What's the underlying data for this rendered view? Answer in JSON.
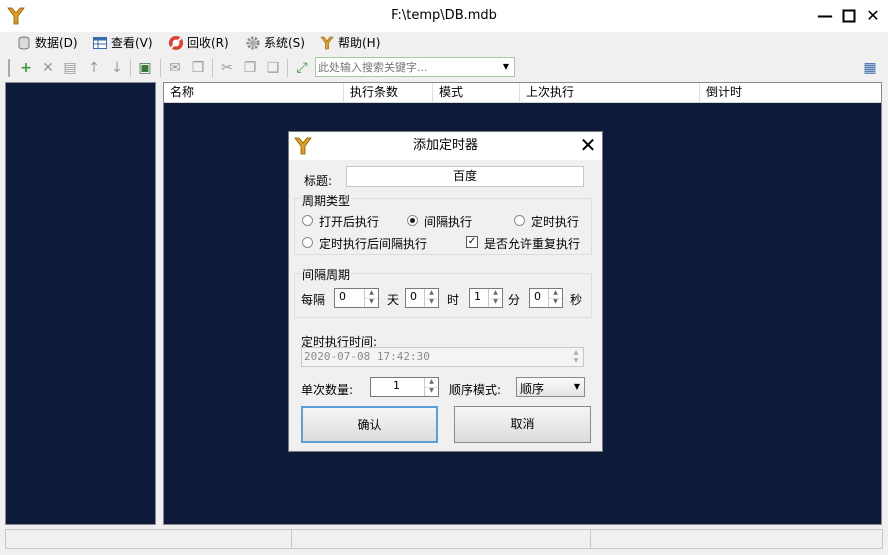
{
  "window": {
    "title": "F:\\temp\\DB.mdb"
  },
  "menu": [
    {
      "label": "数据(D)",
      "icon": "database-icon"
    },
    {
      "label": "查看(V)",
      "icon": "grid-icon"
    },
    {
      "label": "回收(R)",
      "icon": "recycle-icon"
    },
    {
      "label": "系统(S)",
      "icon": "gear-icon"
    },
    {
      "label": "帮助(H)",
      "icon": "help-icon"
    }
  ],
  "toolbar": {
    "search_placeholder": "此处输入搜索关键字..."
  },
  "grid": {
    "columns": [
      "名称",
      "执行条数",
      "模式",
      "上次执行",
      "倒计时"
    ]
  },
  "dialog": {
    "title": "添加定时器",
    "title_label": "标题:",
    "title_value": "百度",
    "period_group": "周期类型",
    "radio_open": "打开后执行",
    "radio_interval": "间隔执行",
    "radio_timed": "定时执行",
    "radio_timed_interval": "定时执行后间隔执行",
    "check_repeat": "是否允许重复执行",
    "interval_group": "间隔周期",
    "every": "每隔",
    "day_value": "0",
    "day_unit": "天",
    "hour_value": "0",
    "hour_unit": "时",
    "minute_value": "1",
    "minute_unit": "分",
    "second_value": "0",
    "second_unit": "秒",
    "time_label": "定时执行时间:",
    "time_value": "2020-07-08 17:42:30",
    "count_label": "单次数量:",
    "count_value": "1",
    "order_label": "顺序模式:",
    "order_value": "顺序",
    "confirm": "确认",
    "cancel": "取消"
  },
  "colors": {
    "panel_bg": "#0d1a3a",
    "accent": "#e0a020"
  }
}
